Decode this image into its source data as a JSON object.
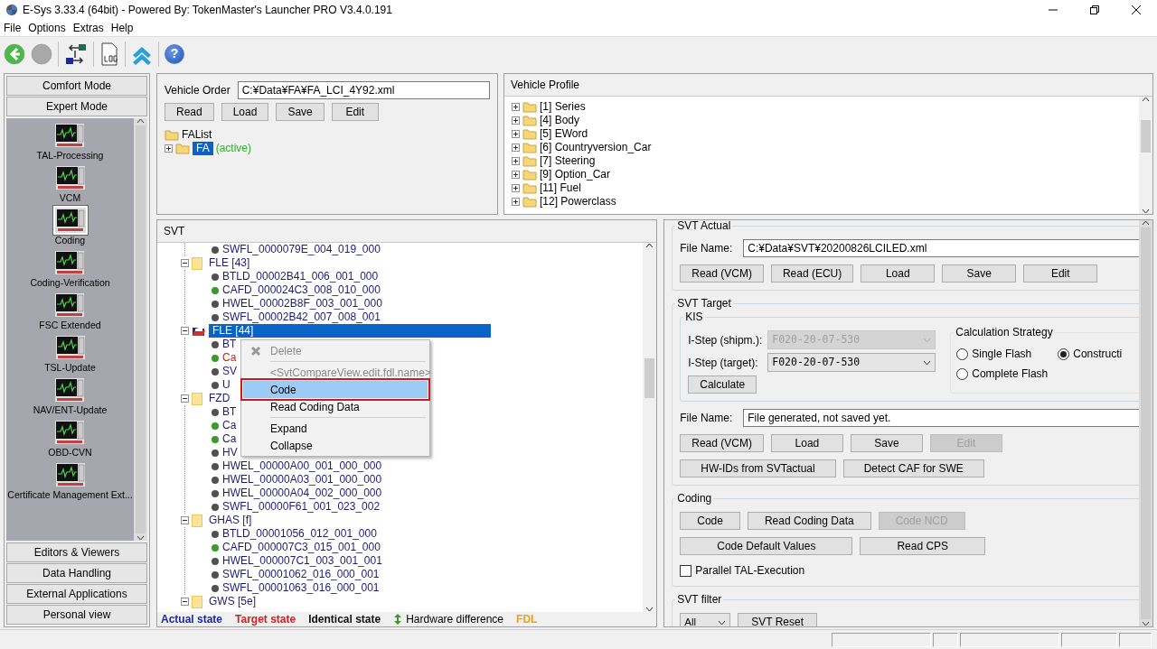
{
  "window": {
    "title": "E-Sys 3.33.4  (64bit) - Powered By: TokenMaster's Launcher PRO V3.4.0.191"
  },
  "menu": [
    "File",
    "Options",
    "Extras",
    "Help"
  ],
  "toolbar": [
    {
      "kind": "back",
      "disabled": false
    },
    {
      "kind": "forward",
      "disabled": true
    },
    {
      "kind": "connect"
    },
    {
      "kind": "log"
    },
    {
      "kind": "expert"
    },
    {
      "kind": "help",
      "label": "?"
    }
  ],
  "sidebar": {
    "top_buttons": [
      "Comfort Mode",
      "Expert Mode"
    ],
    "items": [
      {
        "label": "TAL-Processing",
        "selected": false
      },
      {
        "label": "VCM",
        "selected": false
      },
      {
        "label": "Coding",
        "selected": true
      },
      {
        "label": "Coding-Verification",
        "selected": false
      },
      {
        "label": "FSC Extended",
        "selected": false
      },
      {
        "label": "TSL-Update",
        "selected": false
      },
      {
        "label": "NAV/ENT-Update",
        "selected": false
      },
      {
        "label": "OBD-CVN",
        "selected": false
      },
      {
        "label": "Certificate Management Ext...",
        "selected": false
      }
    ],
    "bottom_buttons": [
      "Editors & Viewers",
      "Data Handling",
      "External Applications",
      "Personal view"
    ]
  },
  "vehicle_order": {
    "label": "Vehicle Order",
    "value": "C:¥Data¥FA¥FA_LCI_4Y92.xml",
    "buttons": [
      "Read",
      "Load",
      "Save",
      "Edit"
    ],
    "tree": {
      "label": "FAList",
      "children": [
        {
          "label": "FA",
          "note": "(active)",
          "selected": true
        }
      ]
    }
  },
  "vehicle_profile": {
    "title": "Vehicle Profile",
    "items": [
      "[1] Series",
      "[4] Body",
      "[5] EWord",
      "[6] Countryversion_Car",
      "[7] Steering",
      "[9] Option_Car",
      "[11] Fuel",
      "[12] Powerclass"
    ]
  },
  "svt": {
    "title": "SVT",
    "groups": [
      {
        "children": [
          {
            "label": "SWFL_0000079E_004_019_000",
            "color": "#505050",
            "target": false
          }
        ]
      },
      {
        "label": "FLE [43]",
        "open": false,
        "selected": false,
        "children": [
          {
            "label": "BTLD_00002B41_006_001_000",
            "color": "#505050",
            "target": false
          },
          {
            "label": "CAFD_000024C3_008_010_000",
            "color": "#3a9a2a",
            "target": false
          },
          {
            "label": "HWEL_00002B8F_003_001_000",
            "color": "#505050",
            "target": false
          },
          {
            "label": "SWFL_00002B42_007_008_001",
            "color": "#505050",
            "target": false
          }
        ]
      },
      {
        "label": "FLE [44]",
        "open": true,
        "selected": true,
        "children": [
          {
            "label": "BT",
            "color": "#505050",
            "target": false
          },
          {
            "label": "Ca",
            "color": "#3a9a2a",
            "target": true
          },
          {
            "label": "SV",
            "color": "#505050",
            "target": false
          },
          {
            "label": "U",
            "color": "#505050",
            "target": false
          }
        ]
      },
      {
        "label": "FZD",
        "open": false,
        "selected": false,
        "children": [
          {
            "label": "BT",
            "color": "#505050",
            "target": false
          },
          {
            "label": "Ca",
            "color": "#3a9a2a",
            "target": false
          },
          {
            "label": "Ca",
            "color": "#3a9a2a",
            "target": false
          },
          {
            "label": "HV",
            "color": "#505050",
            "target": false
          },
          {
            "label": "HWEL_00000A00_001_000_000",
            "color": "#505050",
            "target": false
          },
          {
            "label": "HWEL_00000A03_001_000_000",
            "color": "#505050",
            "target": false
          },
          {
            "label": "HWEL_00000A04_002_000_000",
            "color": "#505050",
            "target": false
          },
          {
            "label": "SWFL_00000F61_001_023_002",
            "color": "#505050",
            "target": false
          }
        ]
      },
      {
        "label": "GHAS [f]",
        "open": false,
        "selected": false,
        "children": [
          {
            "label": "BTLD_00001056_012_001_000",
            "color": "#505050",
            "target": false
          },
          {
            "label": "CAFD_000007C3_015_001_000",
            "color": "#3a9a2a",
            "target": false
          },
          {
            "label": "HWEL_000007C1_003_001_001",
            "color": "#505050",
            "target": false
          },
          {
            "label": "SWFL_00001062_016_000_001",
            "color": "#505050",
            "target": false
          },
          {
            "label": "SWFL_00001063_016_000_001",
            "color": "#505050",
            "target": false
          }
        ]
      },
      {
        "label": "GWS [5e]",
        "open": false,
        "selected": false
      }
    ],
    "legend": [
      {
        "kind": "actual",
        "label": "Actual state"
      },
      {
        "kind": "target",
        "label": "Target state"
      },
      {
        "kind": "identical",
        "label": "Identical state"
      },
      {
        "kind": "hardware",
        "label": "Hardware difference"
      },
      {
        "kind": "fdl",
        "label": "FDL"
      }
    ],
    "context_menu": [
      {
        "kind": "iconitem",
        "label": "Delete",
        "disabled": true,
        "selected": false,
        "outlined": false
      },
      {
        "kind": "separator"
      },
      {
        "kind": "item",
        "label": "<SvtCompareView.edit.fdl.name>",
        "disabled": true,
        "selected": false,
        "outlined": false
      },
      {
        "kind": "item",
        "label": "Code",
        "disabled": false,
        "selected": true,
        "outlined": true
      },
      {
        "kind": "item",
        "label": "Read Coding Data",
        "disabled": false,
        "selected": false,
        "outlined": false
      },
      {
        "kind": "separator"
      },
      {
        "kind": "item",
        "label": "Expand",
        "disabled": false,
        "selected": false,
        "outlined": false
      },
      {
        "kind": "item",
        "label": "Collapse",
        "disabled": false,
        "selected": false,
        "outlined": false
      }
    ]
  },
  "svt_actual": {
    "title": "SVT Actual",
    "file_label": "File Name:",
    "file_value": "C:¥Data¥SVT¥20200826LCILED.xml",
    "buttons": [
      {
        "label": "Read (VCM)",
        "disabled": false
      },
      {
        "label": "Read (ECU)",
        "disabled": false
      },
      {
        "label": "Load",
        "disabled": false
      },
      {
        "label": "Save",
        "disabled": false
      },
      {
        "label": "Edit",
        "disabled": false
      }
    ]
  },
  "svt_target": {
    "title": "SVT Target",
    "kis": {
      "title": "KIS",
      "fields": [
        {
          "label": "I-Step (shipm.):",
          "value": "F020-20-07-530",
          "disabled": true
        },
        {
          "label": "I-Step (target):",
          "value": "F020-20-07-530",
          "disabled": false
        }
      ],
      "button": "Calculate"
    },
    "strategy": {
      "title": "Calculation Strategy",
      "options": [
        {
          "label": "Single Flash",
          "selected": false
        },
        {
          "label": "Constructi",
          "selected": true
        },
        {
          "label": "Complete Flash",
          "selected": false
        }
      ]
    },
    "file_label": "File Name:",
    "file_value": "File generated, not saved yet.",
    "buttons": [
      {
        "label": "Read (VCM)",
        "disabled": false
      },
      {
        "label": "Load",
        "disabled": false
      },
      {
        "label": "Save",
        "disabled": false
      },
      {
        "label": "Edit",
        "disabled": true
      }
    ],
    "buttons2": [
      {
        "label": "HW-IDs from SVTactual",
        "disabled": false
      },
      {
        "label": "Detect CAF for SWE",
        "disabled": false
      }
    ]
  },
  "coding": {
    "title": "Coding",
    "buttons": [
      {
        "label": "Code",
        "disabled": false
      },
      {
        "label": "Read Coding Data",
        "disabled": false
      },
      {
        "label": "Code NCD",
        "disabled": true
      }
    ],
    "buttons2": [
      {
        "label": "Code Default Values",
        "disabled": false
      },
      {
        "label": "Read CPS",
        "disabled": false
      }
    ],
    "checkbox": {
      "label": "Parallel TAL-Execution",
      "checked": false
    }
  },
  "svt_filter": {
    "title": "SVT filter",
    "select": "All",
    "button": "SVT Reset"
  }
}
